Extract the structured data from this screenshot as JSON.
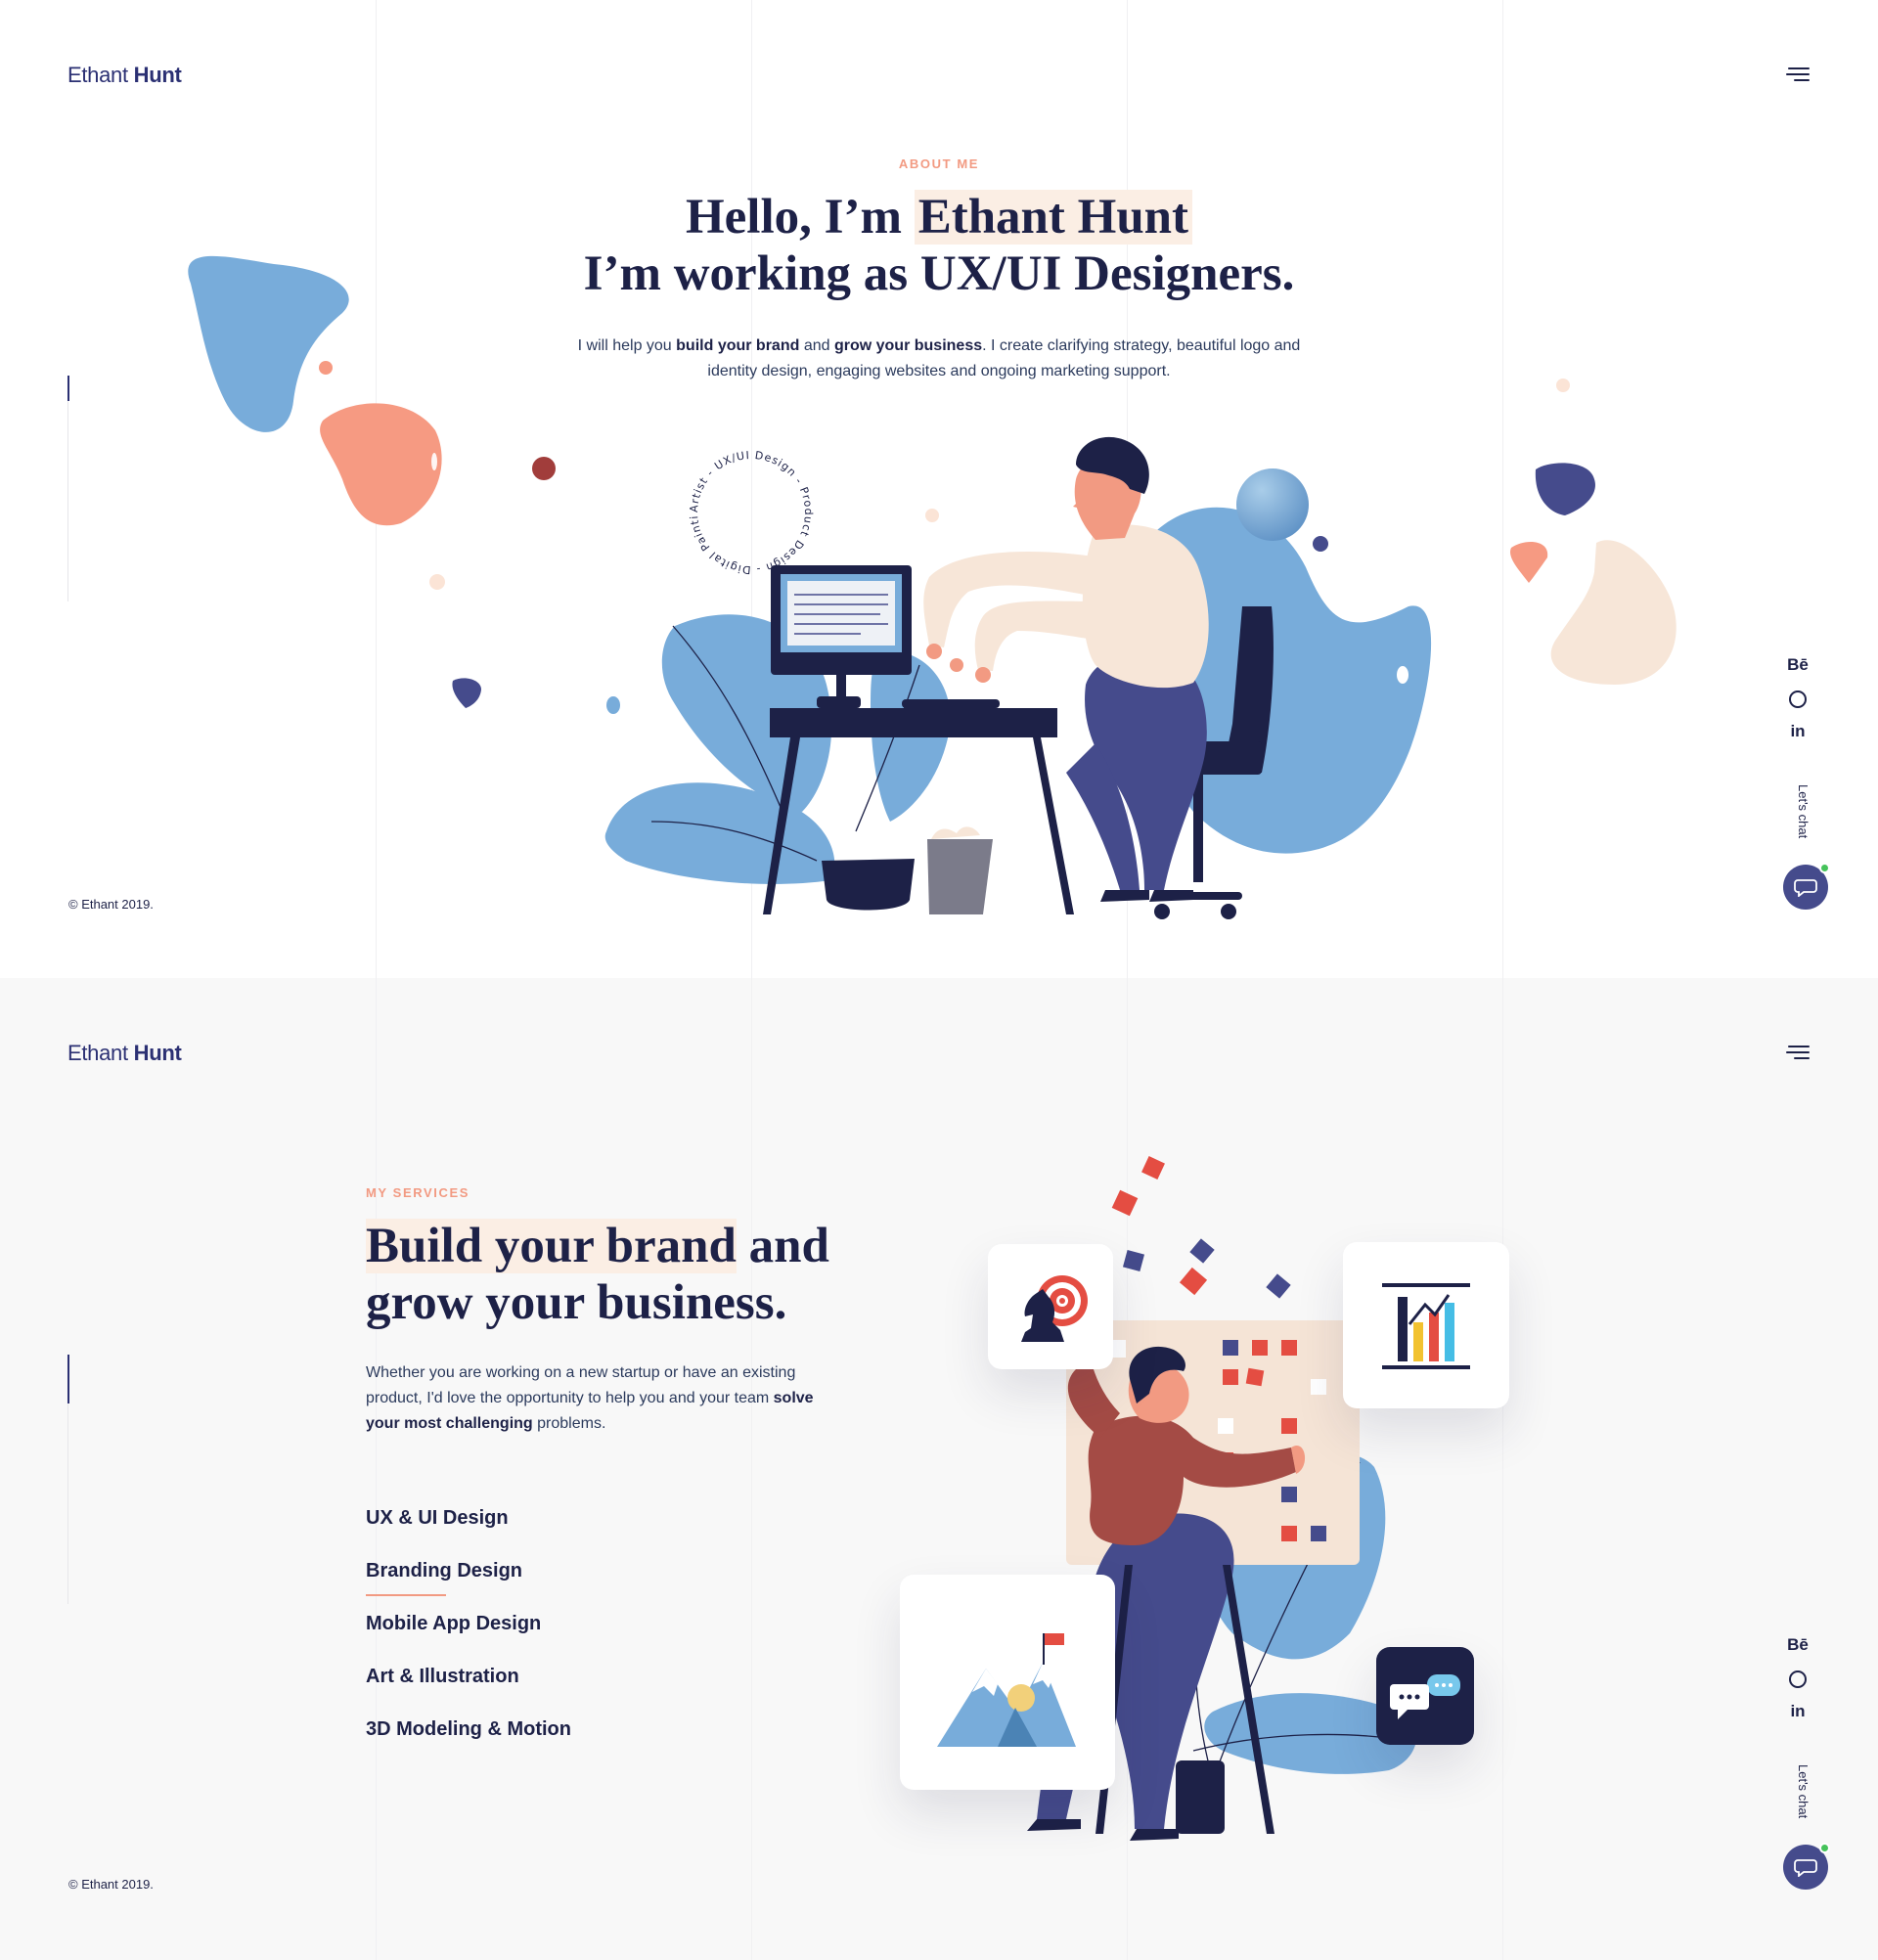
{
  "brand": {
    "first": "Ethant ",
    "last": "Hunt"
  },
  "about": {
    "eyebrow": "ABOUT ME",
    "title_line1_pre": "Hello, I’m ",
    "title_line1_highlight": "Ethant Hunt",
    "title_line2": "I’m working as UX/UI Designers.",
    "desc_part1": "I will help you ",
    "desc_bold1": "build your brand",
    "desc_part2": " and ",
    "desc_bold2": "grow your business",
    "desc_part3": ". I create clarifying strategy, beautiful logo and identity design, engaging websites and ongoing marketing support.",
    "circle_text": "Artist - UX/UI Design - Product Design - Digital Painting - "
  },
  "services": {
    "eyebrow": "MY SERVICES",
    "title_highlight": "Build your brand",
    "title_rest1": " and",
    "title_line2": "grow your business.",
    "desc_part1": "Whether you are working on a new startup or have an existing product, I'd love the opportunity to help you and your team ",
    "desc_bold": "solve your most challenging",
    "desc_part2": " problems.",
    "items": [
      {
        "label": "UX & UI Design"
      },
      {
        "label": "Branding Design"
      },
      {
        "label": "Mobile App Design"
      },
      {
        "label": "Art & Illustration"
      },
      {
        "label": "3D Modeling & Motion"
      }
    ]
  },
  "socials": {
    "behance": "Bē",
    "linkedin": "in"
  },
  "chat": {
    "label": "Let's chat"
  },
  "copyright": "© Ethant 2019.",
  "colors": {
    "navy": "#1d2147",
    "accent": "#f29a82",
    "blue": "#78acda",
    "highlight": "#fbeee4",
    "online": "#46c35b"
  },
  "icons": [
    "menu-icon",
    "behance-icon",
    "dribbble-icon",
    "linkedin-icon",
    "chat-icon"
  ]
}
